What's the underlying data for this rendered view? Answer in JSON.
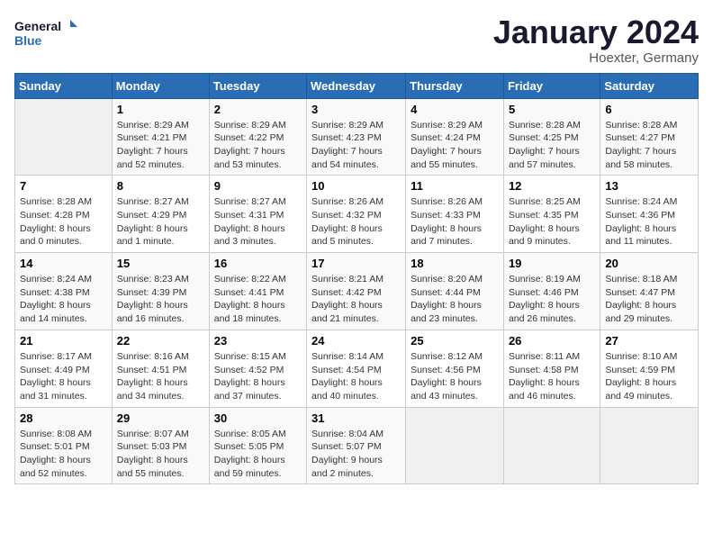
{
  "header": {
    "logo_line1": "General",
    "logo_line2": "Blue",
    "month": "January 2024",
    "location": "Hoexter, Germany"
  },
  "days_of_week": [
    "Sunday",
    "Monday",
    "Tuesday",
    "Wednesday",
    "Thursday",
    "Friday",
    "Saturday"
  ],
  "weeks": [
    [
      {
        "num": "",
        "info": ""
      },
      {
        "num": "1",
        "info": "Sunrise: 8:29 AM\nSunset: 4:21 PM\nDaylight: 7 hours\nand 52 minutes."
      },
      {
        "num": "2",
        "info": "Sunrise: 8:29 AM\nSunset: 4:22 PM\nDaylight: 7 hours\nand 53 minutes."
      },
      {
        "num": "3",
        "info": "Sunrise: 8:29 AM\nSunset: 4:23 PM\nDaylight: 7 hours\nand 54 minutes."
      },
      {
        "num": "4",
        "info": "Sunrise: 8:29 AM\nSunset: 4:24 PM\nDaylight: 7 hours\nand 55 minutes."
      },
      {
        "num": "5",
        "info": "Sunrise: 8:28 AM\nSunset: 4:25 PM\nDaylight: 7 hours\nand 57 minutes."
      },
      {
        "num": "6",
        "info": "Sunrise: 8:28 AM\nSunset: 4:27 PM\nDaylight: 7 hours\nand 58 minutes."
      }
    ],
    [
      {
        "num": "7",
        "info": "Sunrise: 8:28 AM\nSunset: 4:28 PM\nDaylight: 8 hours\nand 0 minutes."
      },
      {
        "num": "8",
        "info": "Sunrise: 8:27 AM\nSunset: 4:29 PM\nDaylight: 8 hours\nand 1 minute."
      },
      {
        "num": "9",
        "info": "Sunrise: 8:27 AM\nSunset: 4:31 PM\nDaylight: 8 hours\nand 3 minutes."
      },
      {
        "num": "10",
        "info": "Sunrise: 8:26 AM\nSunset: 4:32 PM\nDaylight: 8 hours\nand 5 minutes."
      },
      {
        "num": "11",
        "info": "Sunrise: 8:26 AM\nSunset: 4:33 PM\nDaylight: 8 hours\nand 7 minutes."
      },
      {
        "num": "12",
        "info": "Sunrise: 8:25 AM\nSunset: 4:35 PM\nDaylight: 8 hours\nand 9 minutes."
      },
      {
        "num": "13",
        "info": "Sunrise: 8:24 AM\nSunset: 4:36 PM\nDaylight: 8 hours\nand 11 minutes."
      }
    ],
    [
      {
        "num": "14",
        "info": "Sunrise: 8:24 AM\nSunset: 4:38 PM\nDaylight: 8 hours\nand 14 minutes."
      },
      {
        "num": "15",
        "info": "Sunrise: 8:23 AM\nSunset: 4:39 PM\nDaylight: 8 hours\nand 16 minutes."
      },
      {
        "num": "16",
        "info": "Sunrise: 8:22 AM\nSunset: 4:41 PM\nDaylight: 8 hours\nand 18 minutes."
      },
      {
        "num": "17",
        "info": "Sunrise: 8:21 AM\nSunset: 4:42 PM\nDaylight: 8 hours\nand 21 minutes."
      },
      {
        "num": "18",
        "info": "Sunrise: 8:20 AM\nSunset: 4:44 PM\nDaylight: 8 hours\nand 23 minutes."
      },
      {
        "num": "19",
        "info": "Sunrise: 8:19 AM\nSunset: 4:46 PM\nDaylight: 8 hours\nand 26 minutes."
      },
      {
        "num": "20",
        "info": "Sunrise: 8:18 AM\nSunset: 4:47 PM\nDaylight: 8 hours\nand 29 minutes."
      }
    ],
    [
      {
        "num": "21",
        "info": "Sunrise: 8:17 AM\nSunset: 4:49 PM\nDaylight: 8 hours\nand 31 minutes."
      },
      {
        "num": "22",
        "info": "Sunrise: 8:16 AM\nSunset: 4:51 PM\nDaylight: 8 hours\nand 34 minutes."
      },
      {
        "num": "23",
        "info": "Sunrise: 8:15 AM\nSunset: 4:52 PM\nDaylight: 8 hours\nand 37 minutes."
      },
      {
        "num": "24",
        "info": "Sunrise: 8:14 AM\nSunset: 4:54 PM\nDaylight: 8 hours\nand 40 minutes."
      },
      {
        "num": "25",
        "info": "Sunrise: 8:12 AM\nSunset: 4:56 PM\nDaylight: 8 hours\nand 43 minutes."
      },
      {
        "num": "26",
        "info": "Sunrise: 8:11 AM\nSunset: 4:58 PM\nDaylight: 8 hours\nand 46 minutes."
      },
      {
        "num": "27",
        "info": "Sunrise: 8:10 AM\nSunset: 4:59 PM\nDaylight: 8 hours\nand 49 minutes."
      }
    ],
    [
      {
        "num": "28",
        "info": "Sunrise: 8:08 AM\nSunset: 5:01 PM\nDaylight: 8 hours\nand 52 minutes."
      },
      {
        "num": "29",
        "info": "Sunrise: 8:07 AM\nSunset: 5:03 PM\nDaylight: 8 hours\nand 55 minutes."
      },
      {
        "num": "30",
        "info": "Sunrise: 8:05 AM\nSunset: 5:05 PM\nDaylight: 8 hours\nand 59 minutes."
      },
      {
        "num": "31",
        "info": "Sunrise: 8:04 AM\nSunset: 5:07 PM\nDaylight: 9 hours\nand 2 minutes."
      },
      {
        "num": "",
        "info": ""
      },
      {
        "num": "",
        "info": ""
      },
      {
        "num": "",
        "info": ""
      }
    ]
  ]
}
